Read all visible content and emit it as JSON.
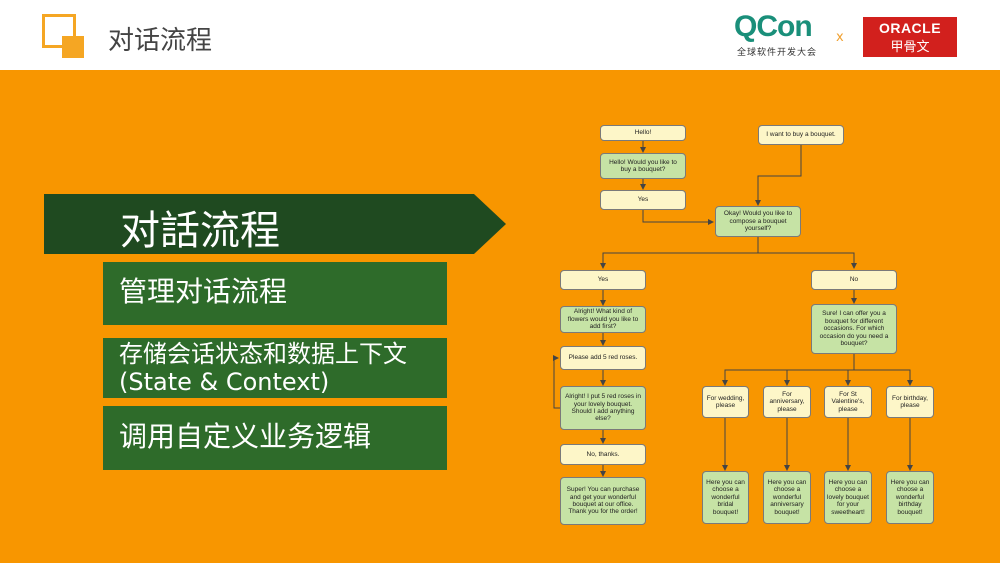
{
  "header": {
    "title": "对话流程",
    "qcon_logo": "QCon",
    "qcon_subtitle": "全球软件开发大会",
    "times": "x",
    "oracle_logo": "ORACLE",
    "oracle_cn": "甲骨文"
  },
  "left": {
    "banner": "对話流程",
    "bullets": [
      "管理对话流程",
      "存储会话状态和数据上下文 (State & Context)",
      "调用自定义业务逻辑"
    ]
  },
  "flowchart": {
    "n1": "Hello!",
    "n2": "Hello! Would you like to buy a bouquet?",
    "n3": "Yes",
    "n4": "I want to buy a bouquet.",
    "n5": "Okay! Would you like to compose a bouquet yourself?",
    "n6": "Yes",
    "n7": "No",
    "n8": "Alright! What kind of flowers would you like to add first?",
    "n9": "Please add 5 red roses.",
    "n10": "Alright! I put 5 red roses in your lovely bouquet. Should I add anything else?",
    "n11": "No, thanks.",
    "n12": "Super! You can purchase and get your wonderful bouquet at our office. Thank you for the order!",
    "n13": "Sure! I can offer you a bouquet for different occasions. For which occasion do you need a bouquet?",
    "n14": "For wedding, please",
    "n15": "For anniversary, please",
    "n16": "For St Valentine's, please",
    "n17": "For birthday, please",
    "n18": "Here you can choose a wonderful bridal bouquet!",
    "n19": "Here you can choose a wonderful anniversary bouquet!",
    "n20": "Here you can choose a lovely bouquet for your sweetheart!",
    "n21": "Here you can choose a wonderful birthday bouquet!"
  },
  "colors": {
    "background": "#f89600",
    "dark_green": "#1f4a20",
    "green": "#2e6b2a",
    "node_yellow": "#fdf6c8",
    "node_green": "#c6e3a5"
  }
}
